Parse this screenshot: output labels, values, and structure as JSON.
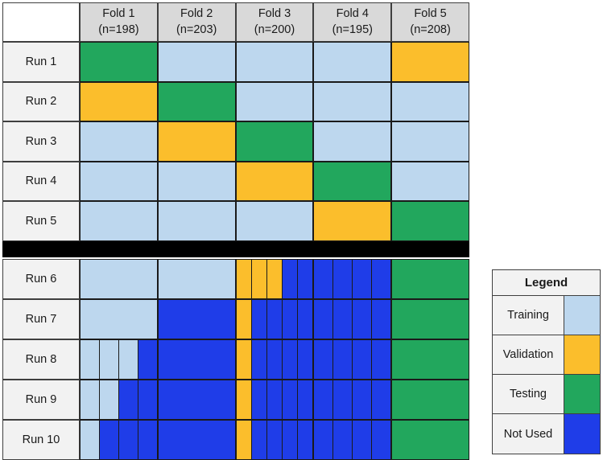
{
  "colors": {
    "training": "#bdd7ee",
    "validation": "#fbbe2c",
    "testing": "#22a75d",
    "not_used": "#1f3de8",
    "header_fill": "#d9d9d9",
    "label_fill": "#f2f2f2",
    "separator": "#000000",
    "border": "#1a1a1a"
  },
  "table": {
    "corner_label": "",
    "folds": [
      {
        "name": "Fold 1",
        "n_label": "(n=198)",
        "n": 198
      },
      {
        "name": "Fold 2",
        "n_label": "(n=203)",
        "n": 203
      },
      {
        "name": "Fold 3",
        "n_label": "(n=200)",
        "n": 200
      },
      {
        "name": "Fold 4",
        "n_label": "(n=195)",
        "n": 195
      },
      {
        "name": "Fold 5",
        "n_label": "(n=208)",
        "n": 208
      }
    ],
    "runs_top": [
      {
        "label": "Run 1",
        "cells": [
          "testing",
          "training",
          "training",
          "training",
          "validation"
        ]
      },
      {
        "label": "Run 2",
        "cells": [
          "validation",
          "testing",
          "training",
          "training",
          "training"
        ]
      },
      {
        "label": "Run 3",
        "cells": [
          "training",
          "validation",
          "testing",
          "training",
          "training"
        ]
      },
      {
        "label": "Run 4",
        "cells": [
          "training",
          "training",
          "validation",
          "testing",
          "training"
        ]
      },
      {
        "label": "Run 5",
        "cells": [
          "training",
          "training",
          "training",
          "validation",
          "testing"
        ]
      }
    ],
    "runs_bottom": [
      {
        "label": "Run 6",
        "cells": [
          {
            "subs": [
              "training"
            ]
          },
          {
            "subs": [
              "training"
            ]
          },
          {
            "subs": [
              "validation",
              "validation",
              "validation",
              "not_used",
              "not_used"
            ]
          },
          {
            "subs": [
              "not_used",
              "not_used",
              "not_used",
              "not_used"
            ]
          },
          {
            "subs": [
              "testing"
            ]
          }
        ]
      },
      {
        "label": "Run 7",
        "cells": [
          {
            "subs": [
              "training"
            ]
          },
          {
            "subs": [
              "not_used"
            ]
          },
          {
            "subs": [
              "validation",
              "not_used",
              "not_used",
              "not_used",
              "not_used"
            ]
          },
          {
            "subs": [
              "not_used",
              "not_used",
              "not_used",
              "not_used"
            ]
          },
          {
            "subs": [
              "testing"
            ]
          }
        ]
      },
      {
        "label": "Run 8",
        "cells": [
          {
            "subs": [
              "training",
              "training",
              "training",
              "not_used"
            ]
          },
          {
            "subs": [
              "not_used"
            ]
          },
          {
            "subs": [
              "validation",
              "not_used",
              "not_used",
              "not_used",
              "not_used"
            ]
          },
          {
            "subs": [
              "not_used",
              "not_used",
              "not_used",
              "not_used"
            ]
          },
          {
            "subs": [
              "testing"
            ]
          }
        ]
      },
      {
        "label": "Run 9",
        "cells": [
          {
            "subs": [
              "training",
              "training",
              "not_used",
              "not_used"
            ]
          },
          {
            "subs": [
              "not_used"
            ]
          },
          {
            "subs": [
              "validation",
              "not_used",
              "not_used",
              "not_used",
              "not_used"
            ]
          },
          {
            "subs": [
              "not_used",
              "not_used",
              "not_used",
              "not_used"
            ]
          },
          {
            "subs": [
              "testing"
            ]
          }
        ]
      },
      {
        "label": "Run 10",
        "cells": [
          {
            "subs": [
              "training",
              "not_used",
              "not_used",
              "not_used"
            ]
          },
          {
            "subs": [
              "not_used"
            ]
          },
          {
            "subs": [
              "validation",
              "not_used",
              "not_used",
              "not_used",
              "not_used"
            ]
          },
          {
            "subs": [
              "not_used",
              "not_used",
              "not_used",
              "not_used"
            ]
          },
          {
            "subs": [
              "testing"
            ]
          }
        ]
      }
    ]
  },
  "legend": {
    "title": "Legend",
    "entries": [
      {
        "label": "Training",
        "key": "training"
      },
      {
        "label": "Validation",
        "key": "validation"
      },
      {
        "label": "Testing",
        "key": "testing"
      },
      {
        "label": "Not Used",
        "key": "not_used"
      }
    ]
  }
}
